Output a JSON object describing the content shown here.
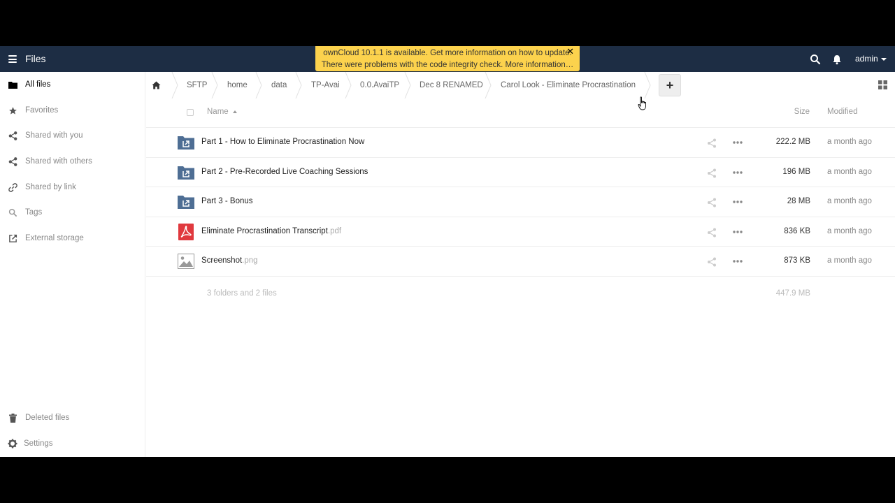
{
  "header": {
    "app_title": "Files",
    "user": "admin",
    "background_color": "#1d2d44"
  },
  "notification": {
    "line1": "ownCloud 10.1.1 is available. Get more information on how to update.",
    "line2": "There were problems with the code integrity check. More information…",
    "close": "✕",
    "color": "#fcd24d"
  },
  "sidebar": {
    "items": [
      {
        "label": "All files",
        "icon": "folder-icon"
      },
      {
        "label": "Favorites",
        "icon": "star-icon"
      },
      {
        "label": "Shared with you",
        "icon": "share-icon"
      },
      {
        "label": "Shared with others",
        "icon": "share-icon"
      },
      {
        "label": "Shared by link",
        "icon": "link-icon"
      },
      {
        "label": "Tags",
        "icon": "tag-icon"
      },
      {
        "label": "External storage",
        "icon": "external-icon"
      }
    ],
    "deleted": "Deleted files",
    "settings": "Settings"
  },
  "breadcrumbs": [
    "SFTP",
    "home",
    "data",
    "TP-Avai",
    "0.0.AvaiTP",
    "Dec 8 RENAMED",
    "Carol Look - Eliminate Procrastination"
  ],
  "new_button": "+",
  "table": {
    "col_name": "Name",
    "col_size": "Size",
    "col_modified": "Modified",
    "rows": [
      {
        "name": "Part 1 - How to Eliminate Procrastination Now",
        "ext": "",
        "type": "shared-folder",
        "size": "222.2 MB",
        "modified": "a month ago"
      },
      {
        "name": "Part 2 - Pre-Recorded Live Coaching Sessions",
        "ext": "",
        "type": "shared-folder",
        "size": "196 MB",
        "modified": "a month ago"
      },
      {
        "name": "Part 3 - Bonus",
        "ext": "",
        "type": "shared-folder",
        "size": "28 MB",
        "modified": "a month ago"
      },
      {
        "name": "Eliminate Procrastination Transcript",
        "ext": ".pdf",
        "type": "pdf",
        "size": "836 KB",
        "modified": "a month ago"
      },
      {
        "name": "Screenshot",
        "ext": ".png",
        "type": "image",
        "size": "873 KB",
        "modified": "a month ago"
      }
    ],
    "summary_count": "3 folders and 2 files",
    "summary_total": "447.9 MB"
  }
}
